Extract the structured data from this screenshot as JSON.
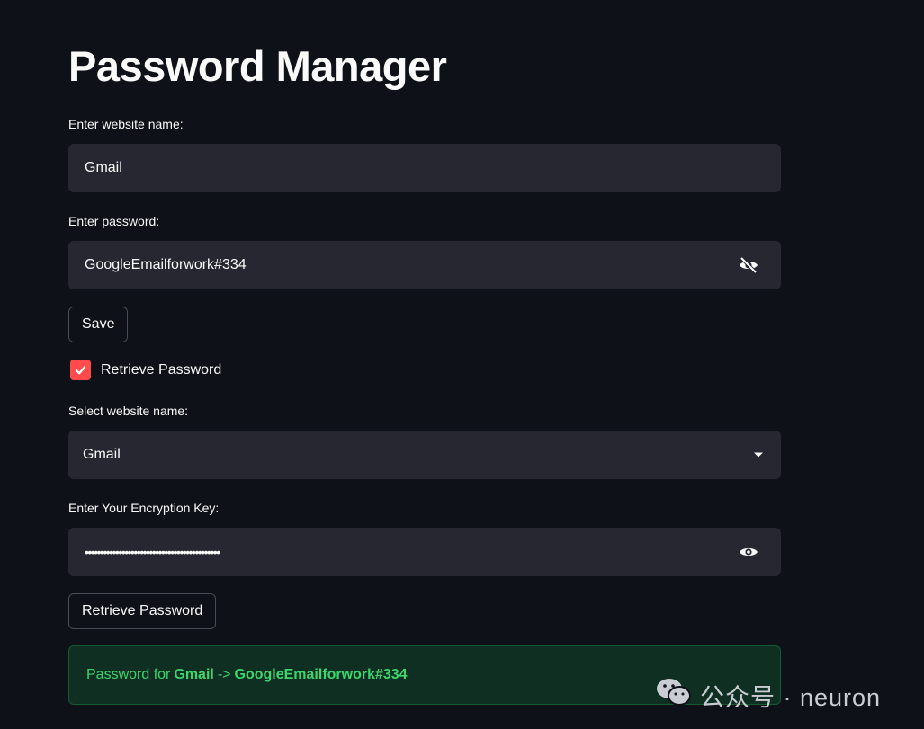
{
  "page": {
    "title": "Password Manager"
  },
  "website_field": {
    "label": "Enter website name:",
    "value": "Gmail"
  },
  "password_field": {
    "label": "Enter password:",
    "value": "GoogleEmailforwork#334",
    "toggle_icon": "eye-off-icon"
  },
  "save_button": {
    "label": "Save"
  },
  "retrieve_checkbox": {
    "label": "Retrieve Password",
    "checked": true
  },
  "select_field": {
    "label": "Select website name:",
    "value": "Gmail"
  },
  "key_field": {
    "label": "Enter Your Encryption Key:",
    "value": "••••••••••••••••••••••••••••••••••••••••••••",
    "toggle_icon": "eye-icon"
  },
  "retrieve_button": {
    "label": "Retrieve Password"
  },
  "result": {
    "prefix": "Password for",
    "site": "Gmail",
    "arrow": "->",
    "password": "GoogleEmailforwork#334"
  },
  "watermark": {
    "text": "公众号 · neuron"
  },
  "colors": {
    "background": "#0e1117",
    "input": "#262730",
    "accent": "#ff4b4b",
    "success_text": "#3dd56d",
    "success_bg": "#0f2f22"
  }
}
